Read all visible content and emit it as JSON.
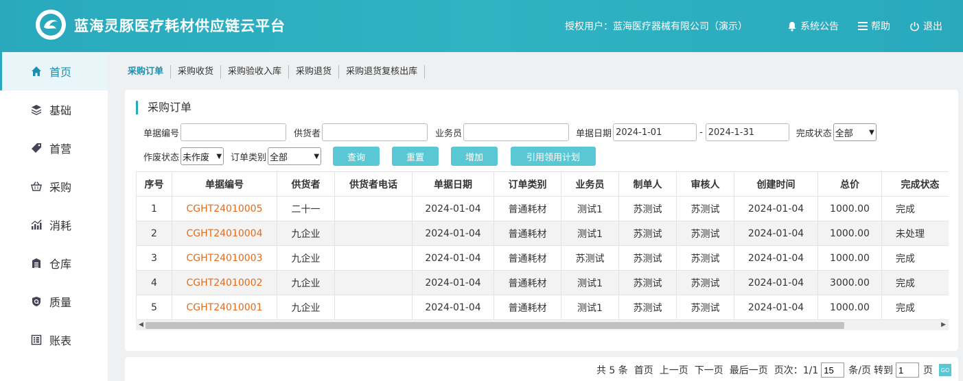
{
  "header": {
    "title": "蓝海灵豚医疗耗材供应链云平台",
    "auth_user": "授权用户：蓝海医疗器械有限公司（演示）",
    "notice": "系统公告",
    "help": "帮助",
    "logout": "退出"
  },
  "sidebar": {
    "items": [
      {
        "label": "首页",
        "icon": "home-icon"
      },
      {
        "label": "基础",
        "icon": "layers-icon"
      },
      {
        "label": "首营",
        "icon": "tag-icon"
      },
      {
        "label": "采购",
        "icon": "basket-icon"
      },
      {
        "label": "消耗",
        "icon": "chart-icon"
      },
      {
        "label": "仓库",
        "icon": "warehouse-icon"
      },
      {
        "label": "质量",
        "icon": "shield-icon"
      },
      {
        "label": "账表",
        "icon": "ledger-icon"
      }
    ]
  },
  "tabs": [
    "采购订单",
    "采购收货",
    "采购验收入库",
    "采购退货",
    "采购退货复核出库"
  ],
  "panel": {
    "title": "采购订单"
  },
  "filters": {
    "doc_no_label": "单据编号",
    "supplier_label": "供货者",
    "salesman_label": "业务员",
    "date_label": "单据日期",
    "date_from": "2024-1-01",
    "date_sep": "-",
    "date_to": "2024-1-31",
    "status_label": "完成状态",
    "status_value": "全部",
    "void_label": "作废状态",
    "void_value": "未作废",
    "type_label": "订单类别",
    "type_value": "全部"
  },
  "buttons": {
    "query": "查询",
    "reset": "重置",
    "add": "增加",
    "plan": "引用领用计划"
  },
  "table": {
    "headers": [
      "序号",
      "单据编号",
      "供货者",
      "供货者电话",
      "单据日期",
      "订单类别",
      "业务员",
      "制单人",
      "审核人",
      "创建时间",
      "总价",
      "完成状态"
    ],
    "rows": [
      [
        "1",
        "CGHT24010005",
        "二十一",
        "",
        "2024-01-04",
        "普通耗材",
        "测试1",
        "苏测试",
        "苏测试",
        "2024-01-04",
        "1000.00",
        "完成"
      ],
      [
        "2",
        "CGHT24010004",
        "九企业",
        "",
        "2024-01-04",
        "普通耗材",
        "测试1",
        "苏测试",
        "苏测试",
        "2024-01-04",
        "1000.00",
        "未处理"
      ],
      [
        "3",
        "CGHT24010003",
        "九企业",
        "",
        "2024-01-04",
        "普通耗材",
        "苏测试",
        "苏测试",
        "苏测试",
        "2024-01-04",
        "1000.00",
        "完成"
      ],
      [
        "4",
        "CGHT24010002",
        "九企业",
        "",
        "2024-01-04",
        "普通耗材",
        "测试1",
        "苏测试",
        "苏测试",
        "2024-01-04",
        "3000.00",
        "完成"
      ],
      [
        "5",
        "CGHT24010001",
        "九企业",
        "",
        "2024-01-04",
        "普通耗材",
        "测试1",
        "苏测试",
        "苏测试",
        "2024-01-04",
        "1000.00",
        "完成"
      ]
    ]
  },
  "pager": {
    "total": "共 5 条",
    "first": "首页",
    "prev": "上一页",
    "next": "下一页",
    "last": "最后一页",
    "page_info": "页次：1/1",
    "page_size": "15",
    "per_page": "条/页",
    "goto": "转到",
    "goto_value": "1",
    "page_unit": "页",
    "go": "GO"
  },
  "colors": {
    "accent": "#2aa9bd",
    "button": "#5ac8d4",
    "link": "#e66a18"
  }
}
